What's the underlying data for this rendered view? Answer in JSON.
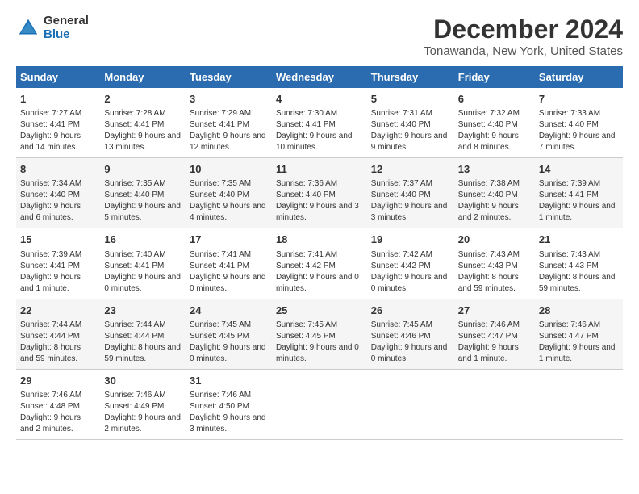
{
  "logo": {
    "general": "General",
    "blue": "Blue"
  },
  "title": "December 2024",
  "subtitle": "Tonawanda, New York, United States",
  "headers": [
    "Sunday",
    "Monday",
    "Tuesday",
    "Wednesday",
    "Thursday",
    "Friday",
    "Saturday"
  ],
  "weeks": [
    [
      {
        "day": "1",
        "sunrise": "7:27 AM",
        "sunset": "4:41 PM",
        "daylight": "9 hours and 14 minutes."
      },
      {
        "day": "2",
        "sunrise": "7:28 AM",
        "sunset": "4:41 PM",
        "daylight": "9 hours and 13 minutes."
      },
      {
        "day": "3",
        "sunrise": "7:29 AM",
        "sunset": "4:41 PM",
        "daylight": "9 hours and 12 minutes."
      },
      {
        "day": "4",
        "sunrise": "7:30 AM",
        "sunset": "4:41 PM",
        "daylight": "9 hours and 10 minutes."
      },
      {
        "day": "5",
        "sunrise": "7:31 AM",
        "sunset": "4:40 PM",
        "daylight": "9 hours and 9 minutes."
      },
      {
        "day": "6",
        "sunrise": "7:32 AM",
        "sunset": "4:40 PM",
        "daylight": "9 hours and 8 minutes."
      },
      {
        "day": "7",
        "sunrise": "7:33 AM",
        "sunset": "4:40 PM",
        "daylight": "9 hours and 7 minutes."
      }
    ],
    [
      {
        "day": "8",
        "sunrise": "7:34 AM",
        "sunset": "4:40 PM",
        "daylight": "9 hours and 6 minutes."
      },
      {
        "day": "9",
        "sunrise": "7:35 AM",
        "sunset": "4:40 PM",
        "daylight": "9 hours and 5 minutes."
      },
      {
        "day": "10",
        "sunrise": "7:35 AM",
        "sunset": "4:40 PM",
        "daylight": "9 hours and 4 minutes."
      },
      {
        "day": "11",
        "sunrise": "7:36 AM",
        "sunset": "4:40 PM",
        "daylight": "9 hours and 3 minutes."
      },
      {
        "day": "12",
        "sunrise": "7:37 AM",
        "sunset": "4:40 PM",
        "daylight": "9 hours and 3 minutes."
      },
      {
        "day": "13",
        "sunrise": "7:38 AM",
        "sunset": "4:40 PM",
        "daylight": "9 hours and 2 minutes."
      },
      {
        "day": "14",
        "sunrise": "7:39 AM",
        "sunset": "4:41 PM",
        "daylight": "9 hours and 1 minute."
      }
    ],
    [
      {
        "day": "15",
        "sunrise": "7:39 AM",
        "sunset": "4:41 PM",
        "daylight": "9 hours and 1 minute."
      },
      {
        "day": "16",
        "sunrise": "7:40 AM",
        "sunset": "4:41 PM",
        "daylight": "9 hours and 0 minutes."
      },
      {
        "day": "17",
        "sunrise": "7:41 AM",
        "sunset": "4:41 PM",
        "daylight": "9 hours and 0 minutes."
      },
      {
        "day": "18",
        "sunrise": "7:41 AM",
        "sunset": "4:42 PM",
        "daylight": "9 hours and 0 minutes."
      },
      {
        "day": "19",
        "sunrise": "7:42 AM",
        "sunset": "4:42 PM",
        "daylight": "9 hours and 0 minutes."
      },
      {
        "day": "20",
        "sunrise": "7:43 AM",
        "sunset": "4:43 PM",
        "daylight": "8 hours and 59 minutes."
      },
      {
        "day": "21",
        "sunrise": "7:43 AM",
        "sunset": "4:43 PM",
        "daylight": "8 hours and 59 minutes."
      }
    ],
    [
      {
        "day": "22",
        "sunrise": "7:44 AM",
        "sunset": "4:44 PM",
        "daylight": "8 hours and 59 minutes."
      },
      {
        "day": "23",
        "sunrise": "7:44 AM",
        "sunset": "4:44 PM",
        "daylight": "8 hours and 59 minutes."
      },
      {
        "day": "24",
        "sunrise": "7:45 AM",
        "sunset": "4:45 PM",
        "daylight": "9 hours and 0 minutes."
      },
      {
        "day": "25",
        "sunrise": "7:45 AM",
        "sunset": "4:45 PM",
        "daylight": "9 hours and 0 minutes."
      },
      {
        "day": "26",
        "sunrise": "7:45 AM",
        "sunset": "4:46 PM",
        "daylight": "9 hours and 0 minutes."
      },
      {
        "day": "27",
        "sunrise": "7:46 AM",
        "sunset": "4:47 PM",
        "daylight": "9 hours and 1 minute."
      },
      {
        "day": "28",
        "sunrise": "7:46 AM",
        "sunset": "4:47 PM",
        "daylight": "9 hours and 1 minute."
      }
    ],
    [
      {
        "day": "29",
        "sunrise": "7:46 AM",
        "sunset": "4:48 PM",
        "daylight": "9 hours and 2 minutes."
      },
      {
        "day": "30",
        "sunrise": "7:46 AM",
        "sunset": "4:49 PM",
        "daylight": "9 hours and 2 minutes."
      },
      {
        "day": "31",
        "sunrise": "7:46 AM",
        "sunset": "4:50 PM",
        "daylight": "9 hours and 3 minutes."
      },
      null,
      null,
      null,
      null
    ]
  ]
}
